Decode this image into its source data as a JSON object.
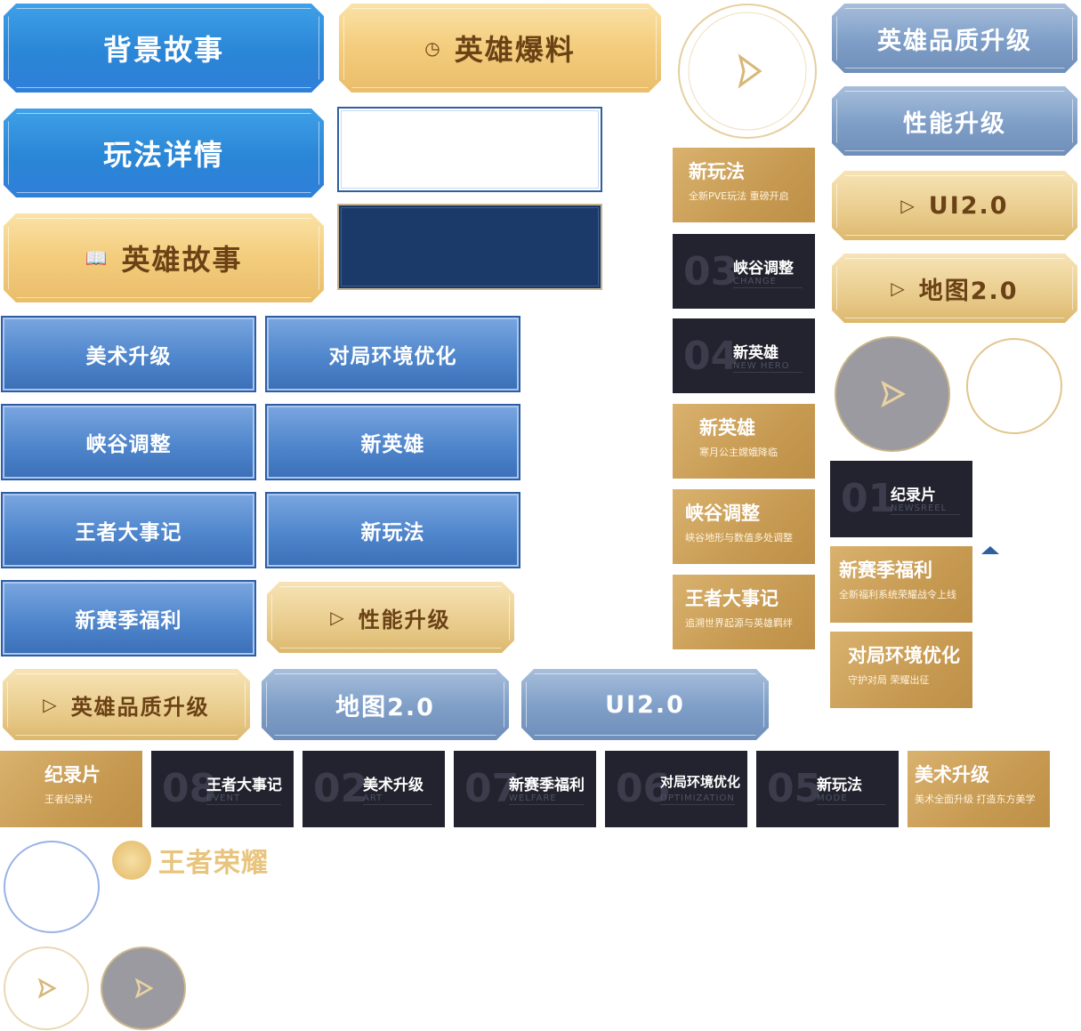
{
  "ornate_buttons": {
    "background_story": "背景故事",
    "hero_news": "英雄爆料",
    "gameplay_details": "玩法详情",
    "hero_story": "英雄故事",
    "hero_quality_upgrade": "英雄品质升级",
    "performance_upgrade": "性能升级",
    "ui2": "UI2.0",
    "map2": "地图2.0",
    "performance_upgrade_gold": "性能升级",
    "hero_quality_upgrade_gold": "英雄品质升级",
    "map2_steel": "地图2.0",
    "ui2_steel": "UI2.0"
  },
  "blue_buttons": {
    "art_upgrade": "美术升级",
    "match_env": "对局环境优化",
    "canyon_adjust": "峡谷调整",
    "new_hero": "新英雄",
    "king_events": "王者大事记",
    "new_gameplay": "新玩法",
    "new_season_welfare": "新赛季福利"
  },
  "gold_cards": [
    {
      "title": "新玩法",
      "subtitle": "全新PVE玩法 重磅开启"
    },
    {
      "title": "新英雄",
      "subtitle": "寒月公主嫦娥降临"
    },
    {
      "title": "峡谷调整",
      "subtitle": "峡谷地形与数值多处调整"
    },
    {
      "title": "王者大事记",
      "subtitle": "追溯世界起源与英雄羁绊"
    },
    {
      "title": "新赛季福利",
      "subtitle": "全新福利系统荣耀战令上线"
    },
    {
      "title": "对局环境优化",
      "subtitle": "守护对局  荣耀出征"
    },
    {
      "title": "纪录片",
      "subtitle": "王者纪录片"
    },
    {
      "title": "美术升级",
      "subtitle": "美术全面升级 打造东方美学"
    }
  ],
  "dark_cards": [
    {
      "num": "03",
      "title": "峡谷调整",
      "sub": "CHANGE"
    },
    {
      "num": "04",
      "title": "新英雄",
      "sub": "NEW HERO"
    },
    {
      "num": "01",
      "title": "纪录片",
      "sub": "NEWSREEL"
    },
    {
      "num": "08",
      "title": "王者大事记",
      "sub": "EVENT"
    },
    {
      "num": "02",
      "title": "美术升级",
      "sub": "ART"
    },
    {
      "num": "07",
      "title": "新赛季福利",
      "sub": "WELFARE"
    },
    {
      "num": "06",
      "title": "对局环境优化",
      "sub": "OPTIMIZATION"
    },
    {
      "num": "05",
      "title": "新玩法",
      "sub": "MODE"
    }
  ],
  "logo": {
    "text": "王者荣耀"
  },
  "icons": {
    "clock": "clock-icon",
    "book": "book-icon",
    "play": "play-icon"
  },
  "colors": {
    "blue": "#2a86d6",
    "gold": "#f3cc7c",
    "steel": "#7e9ec7",
    "dark": "#22232e",
    "navy": "#1b3a69"
  }
}
